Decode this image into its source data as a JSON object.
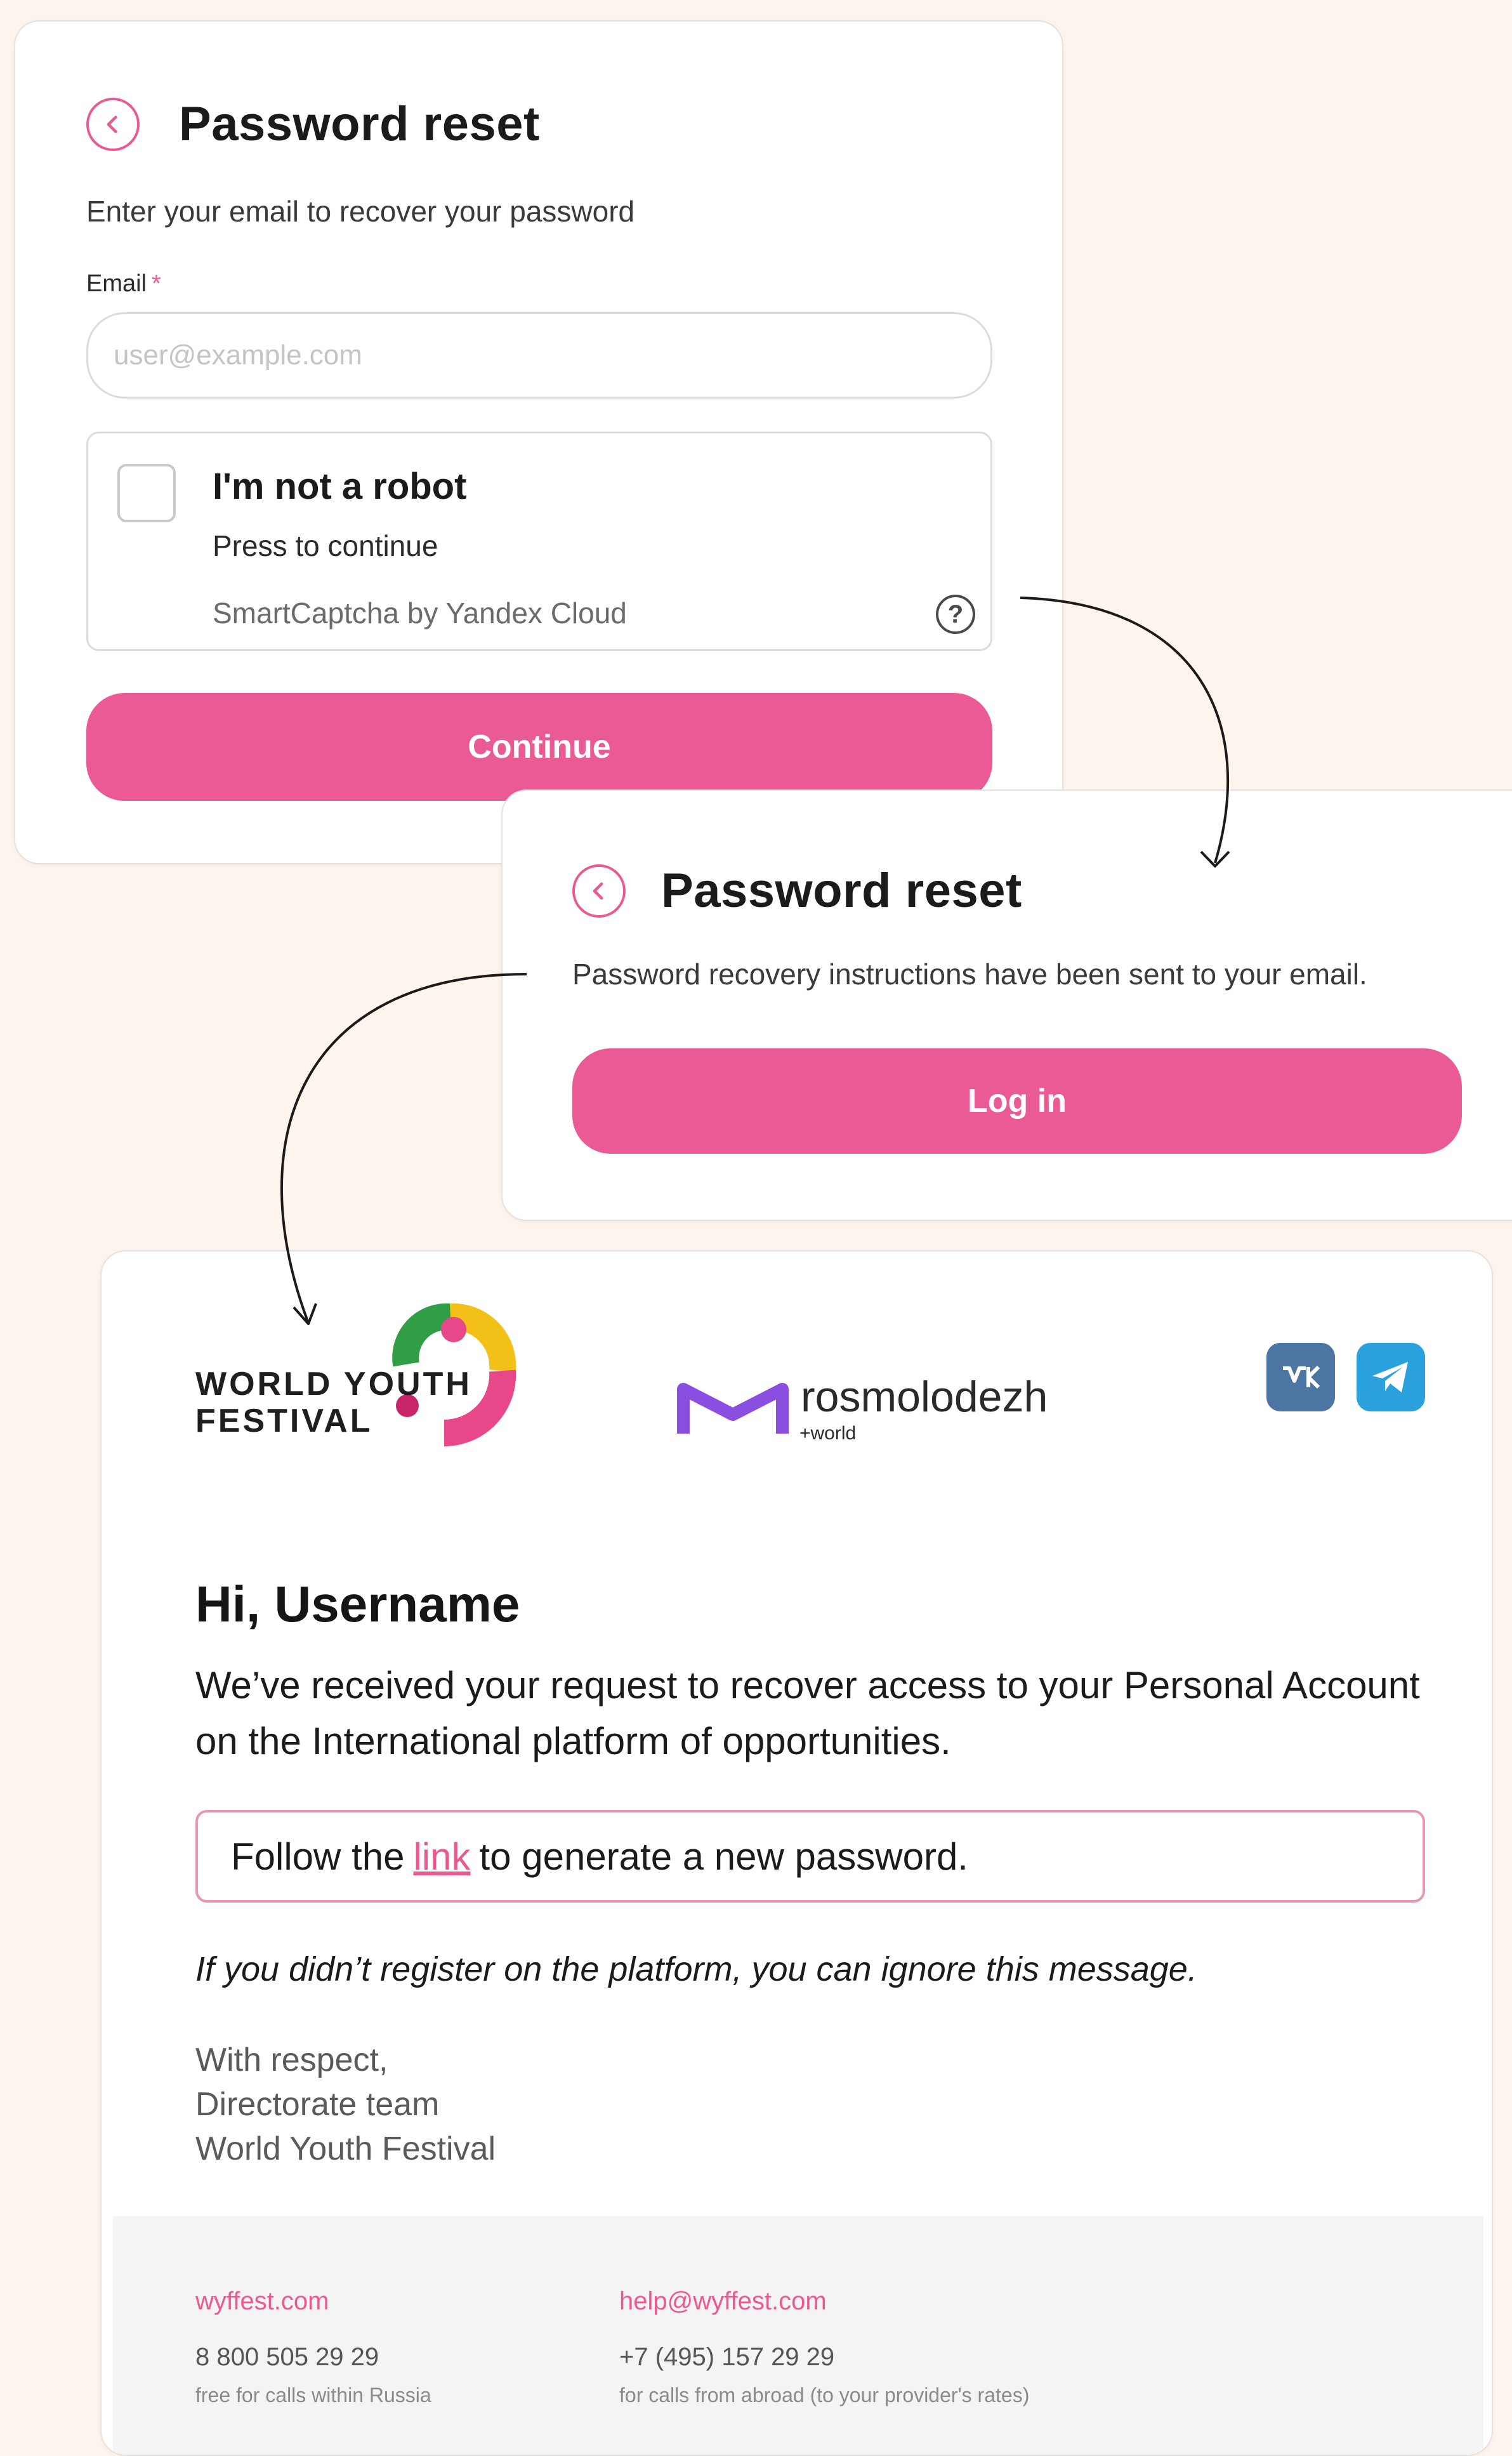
{
  "colors": {
    "accent": "#ea5a94",
    "background": "#fdf4ee",
    "vk": "#4c75a3",
    "telegram": "#2aa0dc"
  },
  "reset_form": {
    "title": "Password reset",
    "subtitle": "Enter your email to recover your password",
    "email_label": "Email",
    "required_mark": "*",
    "email_placeholder": "user@example.com",
    "captcha": {
      "title": "I'm not a robot",
      "subtitle": "Press to continue",
      "brand": "SmartCaptcha by Yandex Cloud",
      "help_glyph": "?"
    },
    "continue_label": "Continue"
  },
  "reset_sent": {
    "title": "Password reset",
    "message": "Password recovery instructions have been sent to your email.",
    "login_label": "Log in"
  },
  "email": {
    "festival_logo": [
      "WORLD YOUTH",
      "FESTIVAL"
    ],
    "partner_name": "rosmolodezh",
    "partner_sub": "+world",
    "social": [
      {
        "name": "vk-icon",
        "glyph": "VK"
      },
      {
        "name": "telegram-icon",
        "glyph": ""
      }
    ],
    "greeting": "Hi, Username",
    "body": "We’ve received your request to recover access to your Personal Account on the International platform of opportunities.",
    "link_prefix": "Follow the",
    "link_text": "link",
    "link_suffix": "to generate a new password.",
    "ignore_note": "If you didn’t register on the platform, you can ignore this message.",
    "signature": [
      "With respect,",
      "Directorate team",
      "World Youth Festival"
    ],
    "footer": {
      "site": "wyffest.com",
      "phone_ru": "8 800 505 29 29",
      "phone_ru_note": "free for calls within Russia",
      "help_email": "help@wyffest.com",
      "phone_intl": "+7 (495) 157 29 29",
      "phone_intl_note": "for calls from abroad (to your provider's rates)"
    }
  }
}
